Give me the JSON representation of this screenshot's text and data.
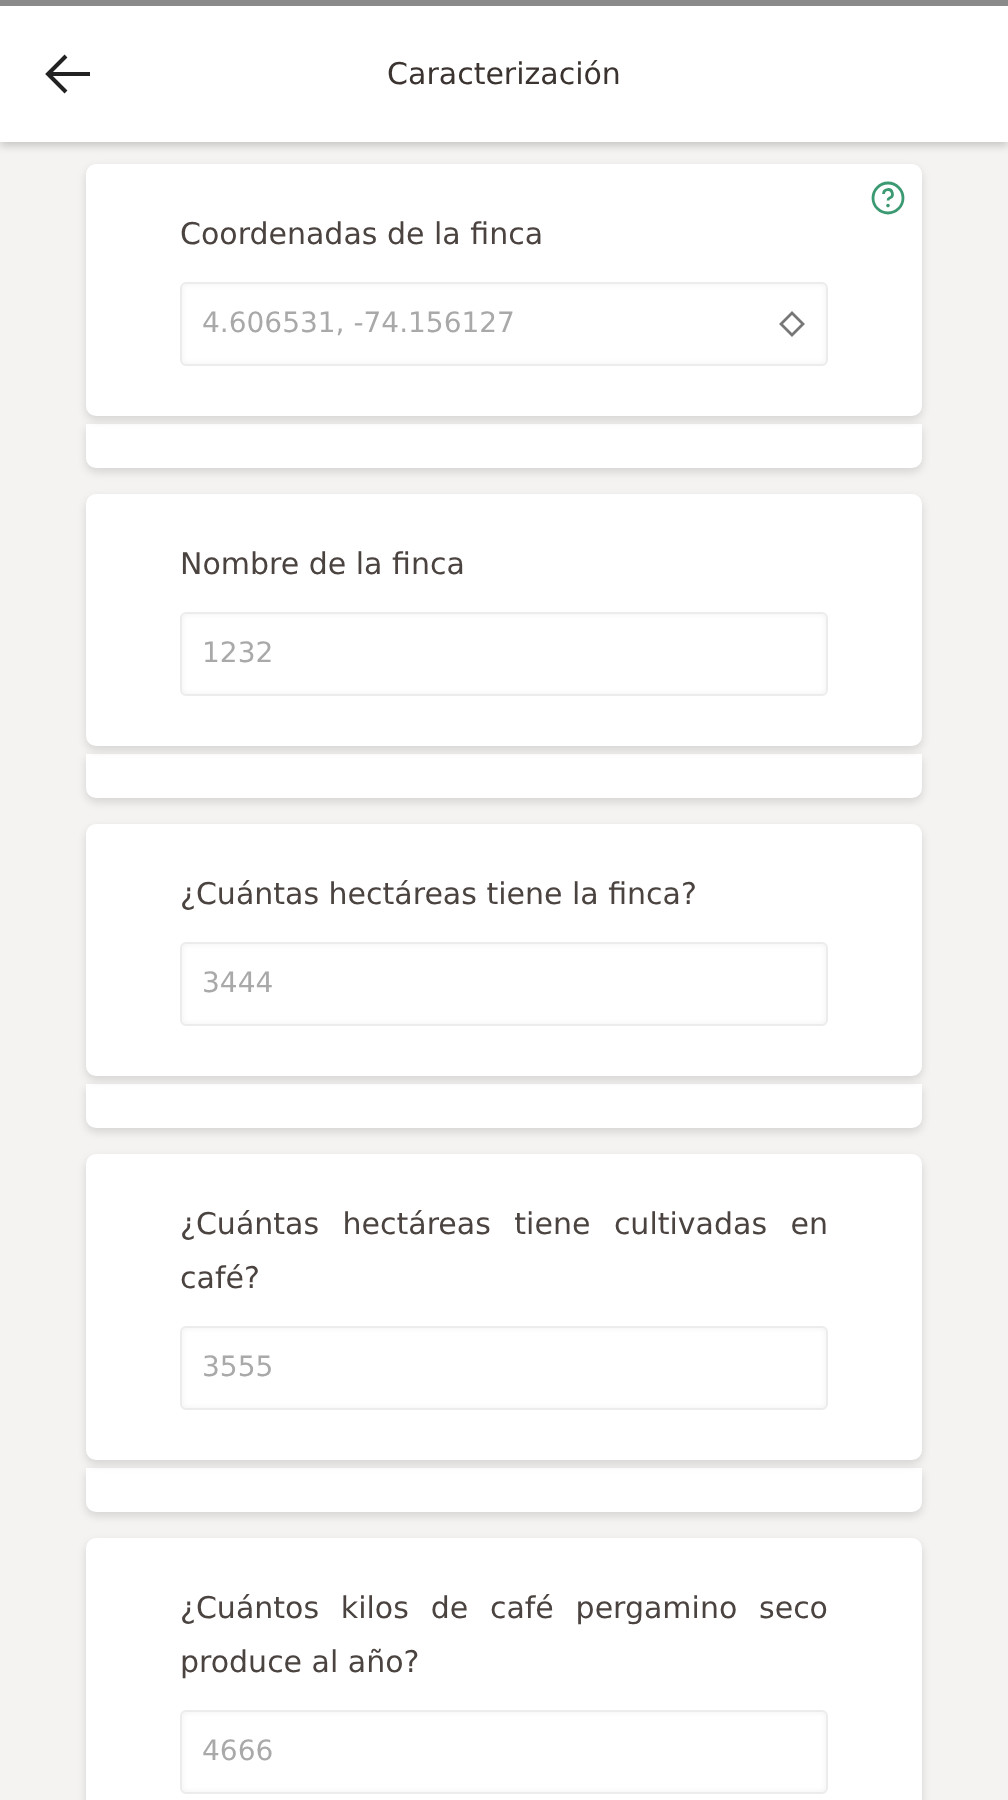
{
  "header": {
    "title": "Caracterización"
  },
  "questions": [
    {
      "label": "Coordenadas de la finca",
      "value": "4.606531, -74.156127",
      "kind": "location",
      "help": true
    },
    {
      "label": "Nombre de la finca",
      "value": "1232",
      "kind": "text",
      "help": false
    },
    {
      "label": "¿Cuántas hectáreas tiene la finca?",
      "value": "3444",
      "kind": "text",
      "help": false
    },
    {
      "label": "¿Cuántas hectáreas tiene cultivadas en café?",
      "value": "3555",
      "kind": "text",
      "help": false
    },
    {
      "label": "¿Cuántos kilos de café pergamino seco produce al año?",
      "value": "4666",
      "kind": "text",
      "help": false
    }
  ]
}
